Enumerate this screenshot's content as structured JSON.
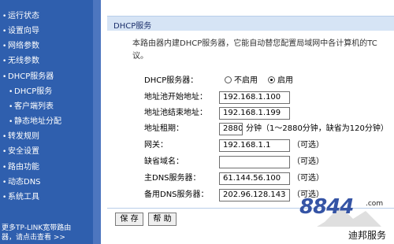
{
  "sidebar": {
    "items": [
      {
        "label": "运行状态",
        "sub": false
      },
      {
        "label": "设置向导",
        "sub": false
      },
      {
        "label": "网络参数",
        "sub": false
      },
      {
        "label": "无线参数",
        "sub": false
      },
      {
        "label": "DHCP服务器",
        "sub": false
      },
      {
        "label": "DHCP服务",
        "sub": true
      },
      {
        "label": "客户端列表",
        "sub": true
      },
      {
        "label": "静态地址分配",
        "sub": true
      },
      {
        "label": "转发规则",
        "sub": false
      },
      {
        "label": "安全设置",
        "sub": false
      },
      {
        "label": "路由功能",
        "sub": false
      },
      {
        "label": "动态DNS",
        "sub": false
      },
      {
        "label": "系统工具",
        "sub": false
      }
    ],
    "footer_line1": "更多TP-LINK宽带路由",
    "footer_line2": "器，请点击查看 >>"
  },
  "panel": {
    "title": "DHCP服务",
    "description": "本路由器内建DHCP服务器，它能自动替您配置局域网中各计算机的TC",
    "description_line2": "议。"
  },
  "form": {
    "dhcp_server_label": "DHCP服务器：",
    "radio_off": "不启用",
    "radio_on": "启用",
    "start_label": "地址池开始地址：",
    "start_value": "192.168.1.100",
    "end_label": "地址池结束地址：",
    "end_value": "192.168.1.199",
    "lease_label": "地址租期：",
    "lease_value": "2880",
    "lease_note": "分钟（1～2880分钟，缺省为120分钟）",
    "gateway_label": "网关：",
    "gateway_value": "192.168.1.1",
    "optional": "（可选）",
    "domain_label": "缺省域名：",
    "domain_value": "",
    "dns1_label": "主DNS服务器：",
    "dns1_value": "61.144.56.100",
    "dns2_label": "备用DNS服务器：",
    "dns2_value": "202.96.128.143"
  },
  "buttons": {
    "save": "保 存",
    "help": "帮 助"
  },
  "watermark": {
    "digits": "8844",
    "domain": ".com",
    "tagline": "迪邦服务"
  },
  "colors": {
    "sidebar": "#2f5fae",
    "panel_header": "#d6e4f5"
  }
}
